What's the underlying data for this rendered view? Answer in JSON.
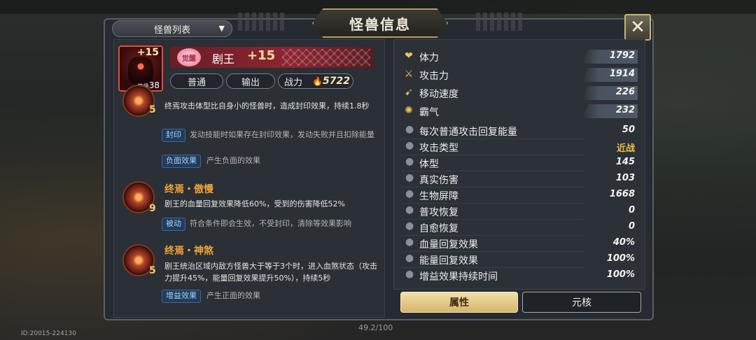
{
  "header": {
    "title": "怪兽信息",
    "list_label": "怪兽列表",
    "close": "✕"
  },
  "monster": {
    "name": "剧王",
    "enhance": "+15",
    "crest": "觉醒",
    "portrait_plus": "+15",
    "level_prefix": "等级",
    "level": "38",
    "type": "普通",
    "role": "输出",
    "power_label": "战力",
    "power": "5722"
  },
  "skills": [
    {
      "level": "5",
      "name": "",
      "desc": "终焉攻击体型比自身小的怪兽时，造成封印效果，持续1.8秒",
      "keywords": [
        {
          "tag": "封印",
          "desc": "发动技能时如果存在封印效果，发动失败并且扣除能量"
        },
        {
          "tag": "负面效果",
          "desc": "产生负面的效果"
        }
      ]
    },
    {
      "level": "9",
      "name": "终焉・傲慢",
      "desc": "剧王的血量回复效果降低60%，受到的伤害降低52%",
      "keywords": [
        {
          "tag": "被动",
          "desc": "符合条件即会生效，不受封印，清除等效果影响"
        }
      ]
    },
    {
      "level": "5",
      "name": "终焉・神煞",
      "desc": "剧王统治区域内敌方怪兽大于等于3个时，进入血煞状态（攻击力提升45%，能量回复效果提升50%），持续5秒",
      "keywords": [
        {
          "tag": "增益效果",
          "desc": "产生正面的效果"
        }
      ]
    }
  ],
  "stats_main": [
    {
      "icon": "heart-icon",
      "glyph": "❤",
      "label": "体力",
      "value": "1792"
    },
    {
      "icon": "sword-icon",
      "glyph": "⚔",
      "label": "攻击力",
      "value": "1914"
    },
    {
      "icon": "boot-icon",
      "glyph": "➹",
      "label": "移动速度",
      "value": "226"
    },
    {
      "icon": "claw-icon",
      "glyph": "✺",
      "label": "霸气",
      "value": "232"
    }
  ],
  "stats_sub": [
    {
      "label": "每次普通攻击回复能量",
      "value": "50"
    },
    {
      "label": "攻击类型",
      "value": "近战"
    },
    {
      "label": "体型",
      "value": "145"
    },
    {
      "label": "真实伤害",
      "value": "103"
    },
    {
      "label": "生物屏障",
      "value": "1668"
    },
    {
      "label": "普攻恢复",
      "value": "0"
    },
    {
      "label": "自愈恢复",
      "value": "0"
    },
    {
      "label": "血量回复效果",
      "value": "40%"
    },
    {
      "label": "能量回复效果",
      "value": "100%"
    },
    {
      "label": "增益效果持续时间",
      "value": "100%"
    }
  ],
  "tabs": {
    "attr": "属性",
    "core": "元核"
  },
  "footer": {
    "id": "ID:20015-224130",
    "hp": "49.2/100"
  },
  "colors": {
    "accent_gold": "#f3c24a",
    "skill_name": "#f3a43a",
    "keyword_blue": "#9fd2ff"
  }
}
